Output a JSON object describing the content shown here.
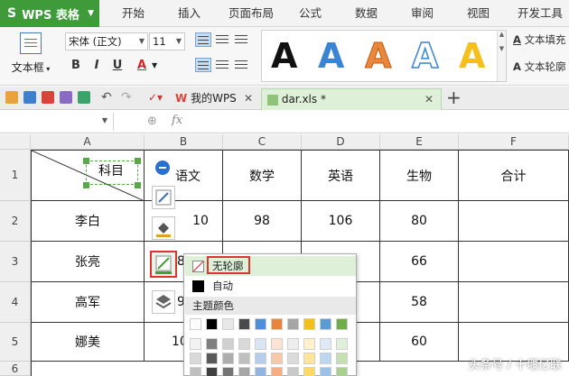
{
  "app": {
    "name": "WPS 表格",
    "logo": "S"
  },
  "menu": [
    "开始",
    "插入",
    "页面布局",
    "公式",
    "数据",
    "审阅",
    "视图",
    "开发工具"
  ],
  "ribbon": {
    "textbox_label": "文本框",
    "font_name": "宋体 (正文)",
    "font_size": "11",
    "format_buttons": [
      "B",
      "I",
      "U",
      "A"
    ],
    "wordart_samples": [
      "A",
      "A",
      "A",
      "A",
      "A"
    ],
    "wordart_colors": [
      "#111111",
      "#3a84d6",
      "#e9883a",
      "#ffffff",
      "#f5c01a"
    ],
    "text_fill_label": "文本填充",
    "text_outline_label": "文本轮廓"
  },
  "tabs": [
    {
      "label": "我的WPS",
      "icon": "wps-logo-icon"
    },
    {
      "label": "dar.xls *",
      "icon": "spreadsheet-icon"
    }
  ],
  "formula_bar": {
    "fx": "fx"
  },
  "sheet": {
    "columns": [
      "A",
      "B",
      "C",
      "D",
      "E",
      "F"
    ],
    "rows": [
      "1",
      "2",
      "3",
      "4",
      "5",
      "6"
    ],
    "header_cells": {
      "A": "科目",
      "B": "语文",
      "C": "数学",
      "D": "英语",
      "E": "生物",
      "F": "合计"
    },
    "data": [
      {
        "name": "李白",
        "b": "10",
        "c": "98",
        "d": "106",
        "e": "80"
      },
      {
        "name": "张亮",
        "b": "8",
        "c": "",
        "d": "",
        "e": "66"
      },
      {
        "name": "高军",
        "b": "9",
        "c": "",
        "d": "",
        "e": "58"
      },
      {
        "name": "娜美",
        "b": "10",
        "c": "",
        "d": "",
        "e": "60"
      }
    ]
  },
  "outline_menu": {
    "no_outline": "无轮廓",
    "automatic": "自动",
    "theme_colors": "主题颜色",
    "theme_row": [
      "#ffffff",
      "#000000",
      "#e8e8e8",
      "#4a4a4a",
      "#4f8fd9",
      "#e9843a",
      "#a5a5a5",
      "#f5bf19",
      "#5b9bd5",
      "#70ad47"
    ],
    "shade_columns": [
      [
        "#f2f2f2",
        "#d9d9d9",
        "#bfbfbf",
        "#a6a6a6"
      ],
      [
        "#7f7f7f",
        "#595959",
        "#404040",
        "#262626"
      ],
      [
        "#d0d0d0",
        "#aeaeae",
        "#757575",
        "#3a3a3a"
      ],
      [
        "#d9d9d9",
        "#bfbfbf",
        "#a6a6a6",
        "#808080"
      ],
      [
        "#dbe6f4",
        "#b7cdea",
        "#93b4df",
        "#2f5f9b"
      ],
      [
        "#fbe4d5",
        "#f7c9ab",
        "#f4ae82",
        "#b55d1f"
      ],
      [
        "#ededed",
        "#dbdbdb",
        "#c9c9c9",
        "#7b7b7b"
      ],
      [
        "#fff2cc",
        "#ffe599",
        "#ffd966",
        "#bf9000"
      ],
      [
        "#deebf7",
        "#bdd7ee",
        "#9cc3e5",
        "#2e75b6"
      ],
      [
        "#e2efda",
        "#c6e0b4",
        "#a9d08e",
        "#548235"
      ]
    ]
  },
  "watermark": "头条号 / 十堰亿联"
}
